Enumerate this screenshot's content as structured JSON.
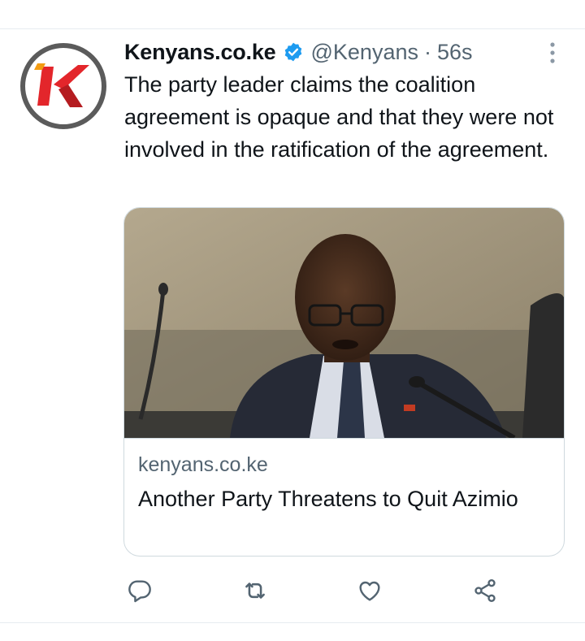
{
  "tweet": {
    "display_name": "Kenyans.co.ke",
    "handle": "@Kenyans",
    "separator": "·",
    "timestamp": "56s",
    "text": "The party leader claims the coalition agreement is opaque and that they were not involved in the ratification of the agreement."
  },
  "avatar": {
    "logo_letter": "K",
    "brand_color": "#e3262b",
    "ring_color": "#5b5b5b"
  },
  "card": {
    "domain": "kenyans.co.ke",
    "title": "Another Party Threatens to Quit Azimio"
  },
  "actions": [
    {
      "name": "reply-icon"
    },
    {
      "name": "retweet-icon"
    },
    {
      "name": "like-icon"
    },
    {
      "name": "share-icon"
    }
  ],
  "colors": {
    "text_primary": "#0f1419",
    "text_secondary": "#536471",
    "verified_blue": "#1d9bf0",
    "border": "#cfd9de"
  }
}
